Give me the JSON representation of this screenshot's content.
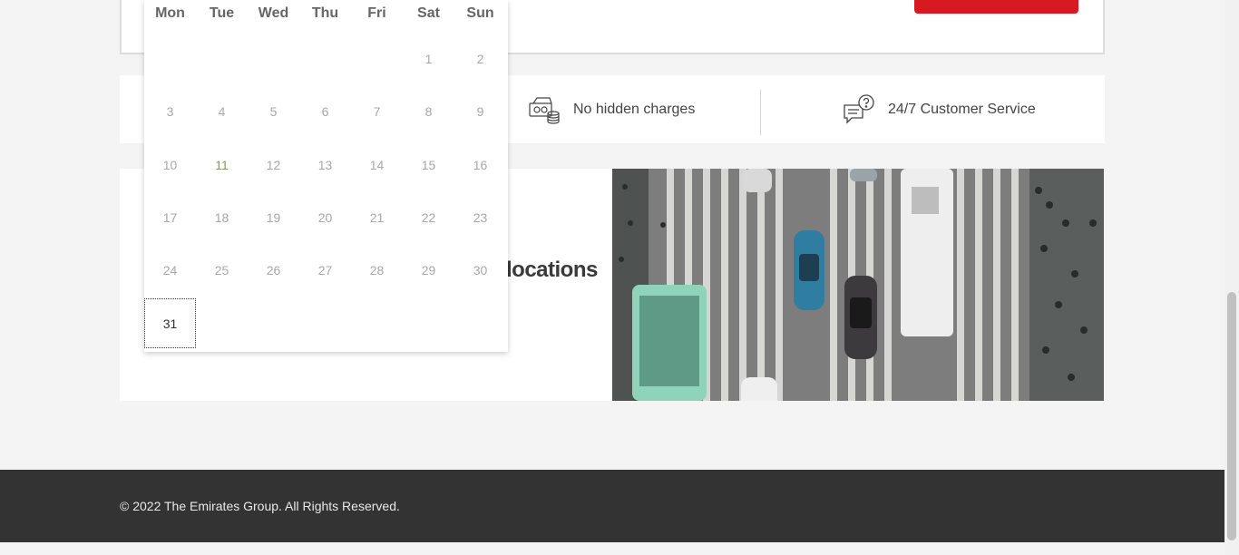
{
  "features": {
    "item1": "No hidden charges",
    "item2": "24/7 Customer Service"
  },
  "promo": {
    "headline": "locations",
    "image_alt": "Aerial view of city traffic and pedestrian crossing"
  },
  "footer": {
    "copyright": "© 2022 The Emirates Group. All Rights Reserved."
  },
  "calendar": {
    "weekdays": [
      "Mon",
      "Tue",
      "Wed",
      "Thu",
      "Fri",
      "Sat",
      "Sun"
    ],
    "days": {
      "d1": "1",
      "d2": "2",
      "d3": "3",
      "d4": "4",
      "d5": "5",
      "d6": "6",
      "d7": "7",
      "d8": "8",
      "d9": "9",
      "d10": "10",
      "d11": "11",
      "d12": "12",
      "d13": "13",
      "d14": "14",
      "d15": "15",
      "d16": "16",
      "d17": "17",
      "d18": "18",
      "d19": "19",
      "d20": "20",
      "d21": "21",
      "d22": "22",
      "d23": "23",
      "d24": "24",
      "d25": "25",
      "d26": "26",
      "d27": "27",
      "d28": "28",
      "d29": "29",
      "d30": "30",
      "d31": "31"
    },
    "selected_day": "31"
  },
  "colors": {
    "accent": "#d71a21",
    "footer_bg": "#333333"
  },
  "icons": {
    "charges": "money-icon",
    "service": "chat-support-icon"
  }
}
